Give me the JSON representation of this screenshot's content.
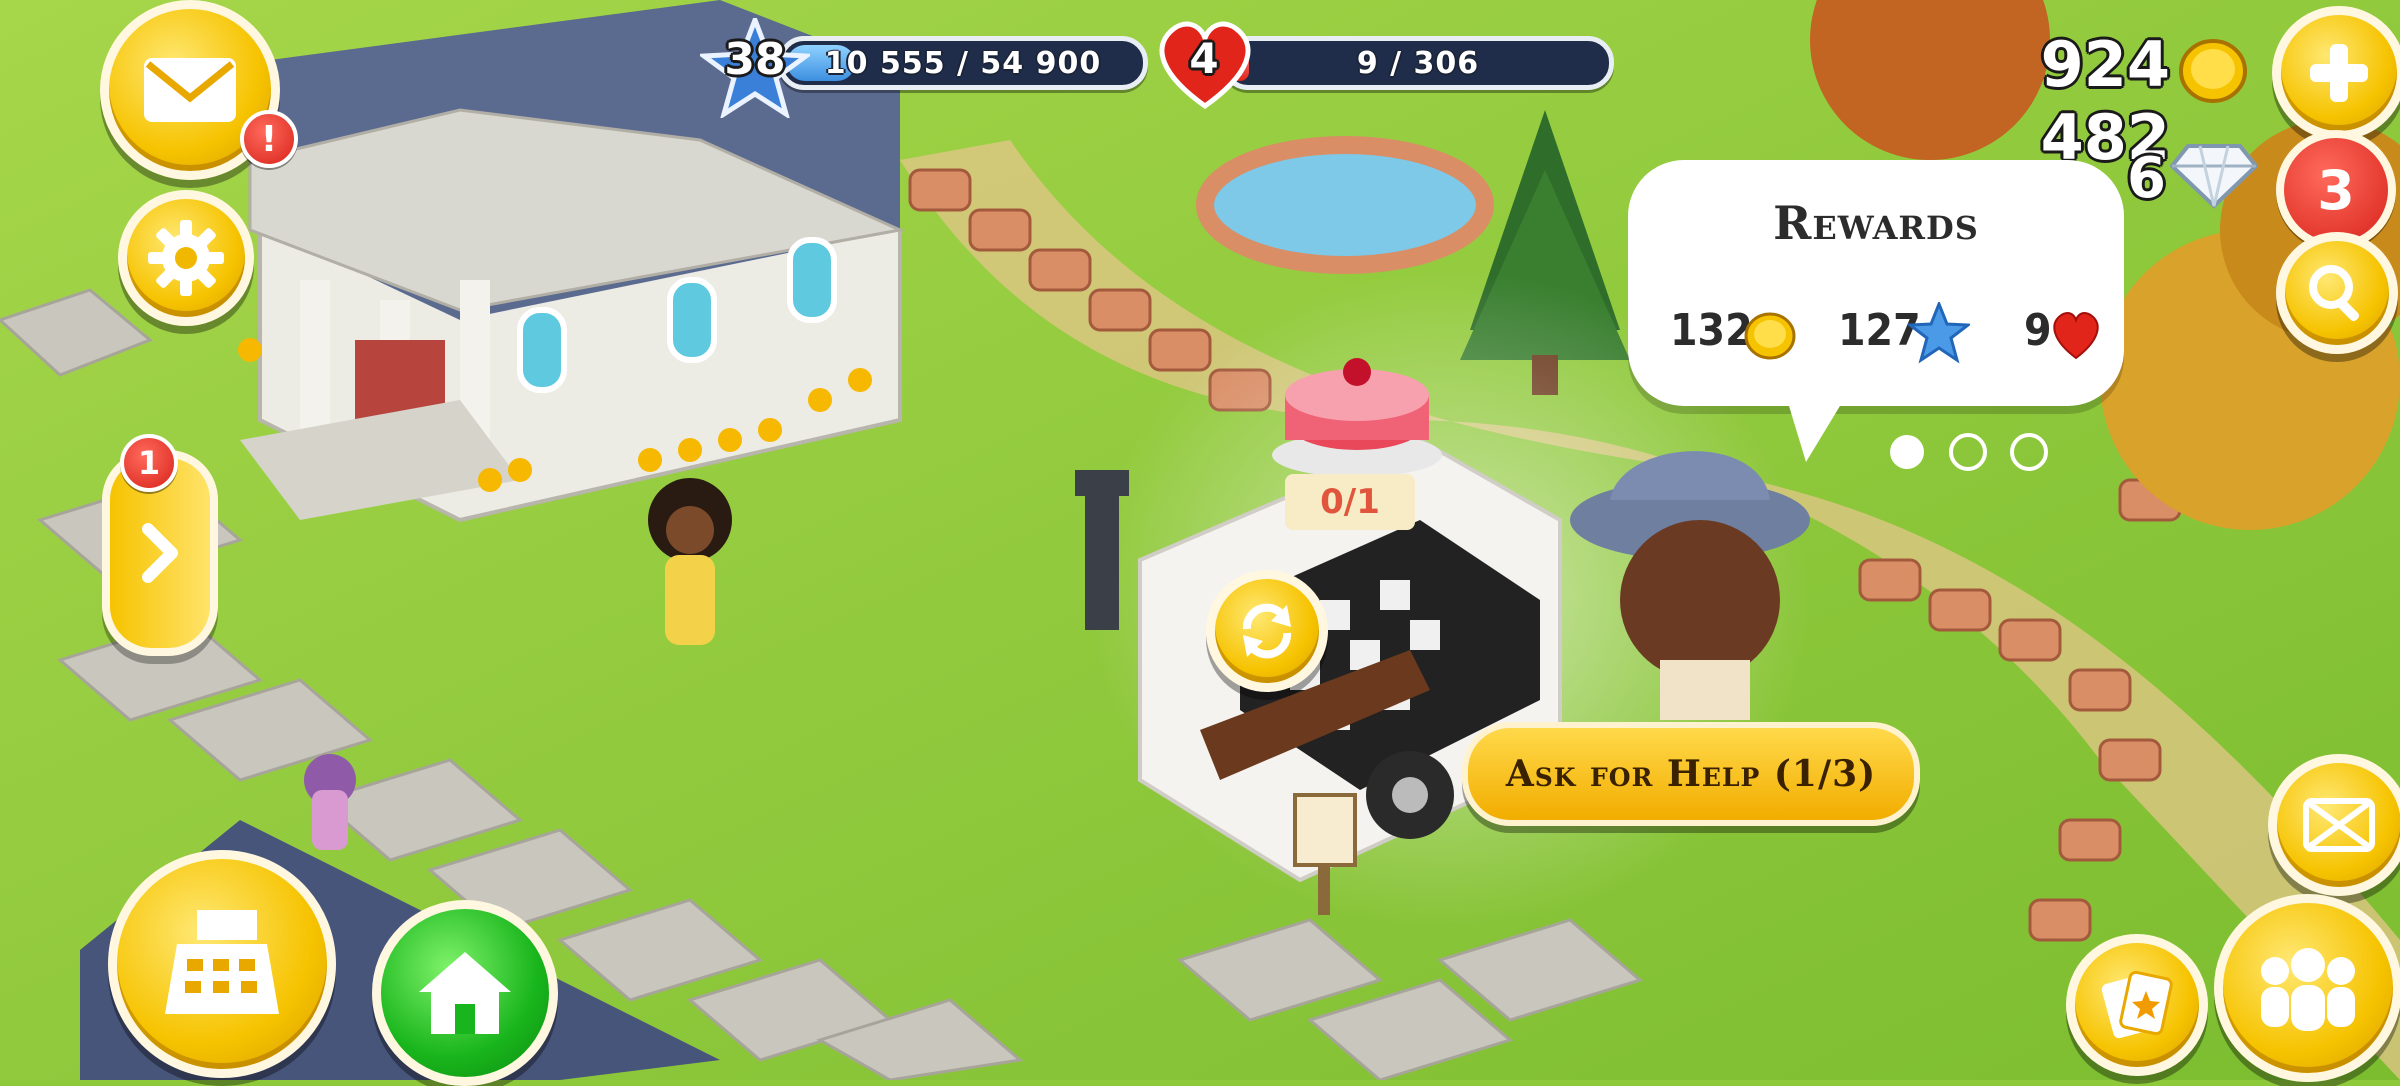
{
  "hud": {
    "level": "38",
    "xp_text": "10 555 / 54 900",
    "xp_progress": 0.192,
    "hearts_level": "4",
    "hearts_text": "9 / 306",
    "hearts_progress": 0.029,
    "coins": "924 482",
    "diamonds": "6",
    "diamond_badge": "3"
  },
  "left_panel": {
    "mail_alert": "!",
    "side_arrow_badge": "1"
  },
  "order": {
    "progress_label": "0/1",
    "rewards": {
      "title": "Rewards",
      "coins": "132",
      "xp": "127",
      "hearts": "9"
    },
    "ask_help_label": "Ask for Help (1/3)"
  },
  "icons": {
    "mail": "mail-icon",
    "settings": "gear-icon",
    "arrow": "chevron-right-icon",
    "cash_register": "cash-register-icon",
    "home": "home-icon",
    "plus": "plus-icon",
    "search": "magnifier-icon",
    "expand": "expand-icon",
    "cards": "cards-icon",
    "friends": "friends-icon",
    "refresh": "refresh-icon"
  },
  "colors": {
    "gold": "#f6c300",
    "grass": "#8ec93a",
    "xp_blue": "#3c8fe0",
    "heart_red": "#e1251b"
  }
}
